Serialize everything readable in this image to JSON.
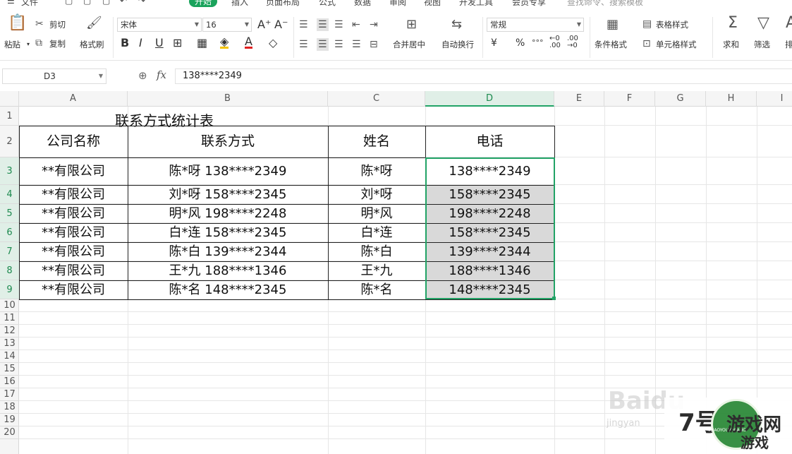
{
  "tabs": [
    "文件",
    "开始",
    "插入",
    "页面布局",
    "公式",
    "数据",
    "审阅",
    "视图",
    "开发工具",
    "会员专享",
    "查找命令、搜索模板"
  ],
  "ribbon": {
    "paste": "粘贴",
    "cut": "剪切",
    "copy": "复制",
    "format_painter": "格式刷",
    "font_name": "宋体",
    "font_size": "16",
    "merge_center": "合并居中",
    "auto_wrap": "自动换行",
    "number_format": "常规",
    "cond_format": "条件格式",
    "table_style": "表格样式",
    "cell_style": "单元格样式",
    "sum": "求和",
    "filter": "筛选",
    "sort_partial": "排",
    "currency_symbol": "¥",
    "percent_symbol": "%"
  },
  "formula_bar": {
    "name_box": "D3",
    "content": "138****2349"
  },
  "sheet": {
    "columns": [
      "A",
      "B",
      "C",
      "D",
      "E",
      "F",
      "G",
      "H",
      "I"
    ],
    "rows": [
      "1",
      "2",
      "3",
      "4",
      "5",
      "6",
      "7",
      "8",
      "9",
      "10",
      "11",
      "12",
      "13",
      "14",
      "15",
      "16",
      "17",
      "18",
      "19",
      "20"
    ],
    "selected_column": "D",
    "selected_range": "D3:D9",
    "table_title": "联系方式统计表",
    "headers": [
      "公司名称",
      "联系方式",
      "姓名",
      "电话"
    ],
    "data": [
      [
        "**有限公司",
        "陈*呀 138****2349",
        "陈*呀",
        "138****2349"
      ],
      [
        "**有限公司",
        "刘*呀 158****2345",
        "刘*呀",
        "158****2345"
      ],
      [
        "**有限公司",
        "明*风 198****2248",
        "明*风",
        "198****2248"
      ],
      [
        "**有限公司",
        "白*连 158****2345",
        "白*连",
        "158****2345"
      ],
      [
        "**有限公司",
        "陈*白 139****2344",
        "陈*白",
        "139****2344"
      ],
      [
        "**有限公司",
        "王*九 188****1346",
        "王*九",
        "188****1346"
      ],
      [
        "**有限公司",
        "陈*名 148****2345",
        "陈*名",
        "148****2345"
      ]
    ]
  },
  "watermark": {
    "baidu": "Baidu",
    "jingyan": "jingyan",
    "site_num": "7号",
    "site_name1": "游戏网",
    "site_name2": "游戏",
    "site_mini": "7HAOYOUXIWANG"
  }
}
